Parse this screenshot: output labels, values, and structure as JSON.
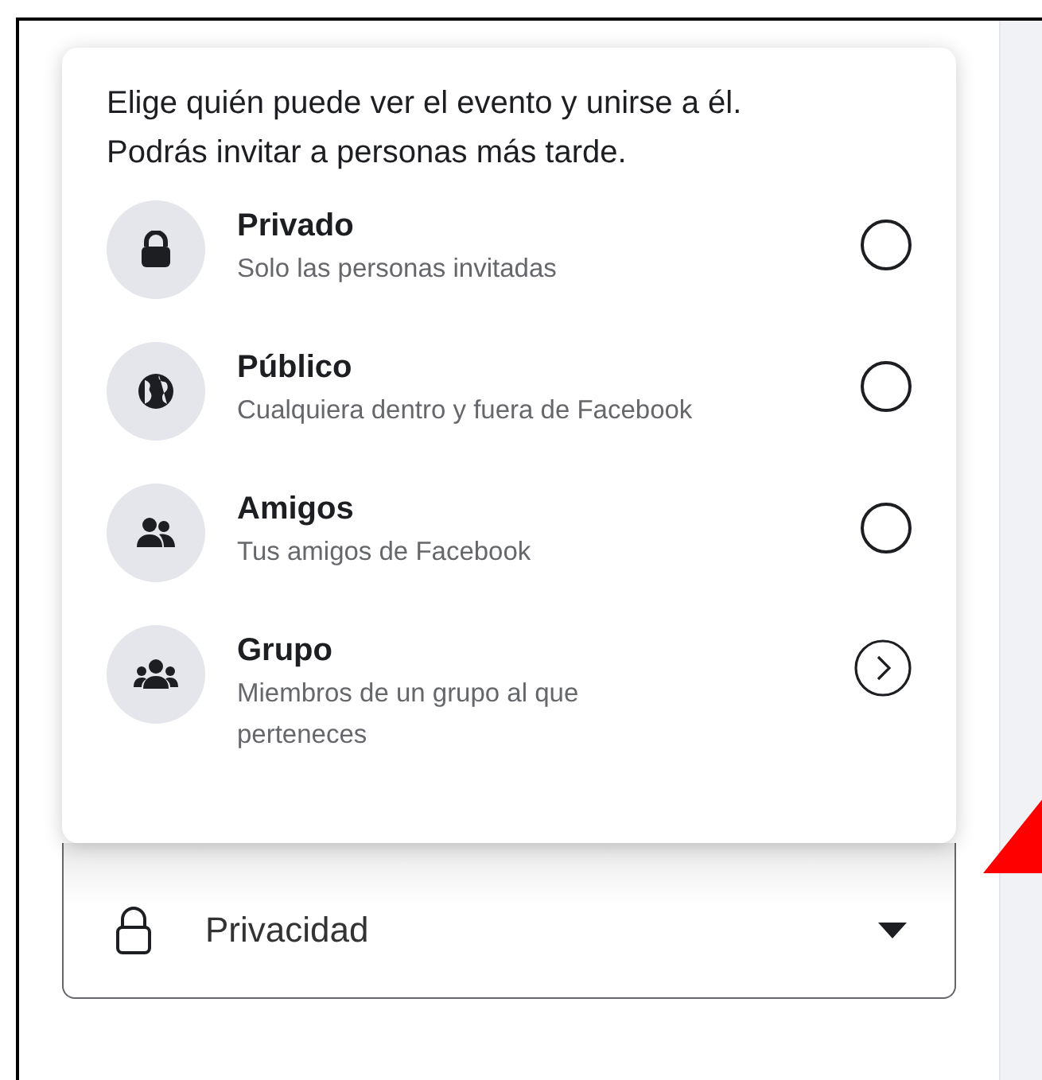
{
  "menu": {
    "description": "Elige quién puede ver el evento y unirse a él. Podrás invitar a personas más tarde.",
    "options": [
      {
        "kind": "radio",
        "title": "Privado",
        "subtitle": "Solo las personas invitadas",
        "selected": false
      },
      {
        "kind": "radio",
        "title": "Público",
        "subtitle": "Cualquiera dentro y fuera de Facebook",
        "selected": false
      },
      {
        "kind": "radio",
        "title": "Amigos",
        "subtitle": "Tus amigos de Facebook",
        "selected": false
      },
      {
        "kind": "submenu",
        "title": "Grupo",
        "subtitle": "Miembros de un grupo al que perteneces"
      }
    ]
  },
  "privacy_field": {
    "label": "Privacidad"
  }
}
